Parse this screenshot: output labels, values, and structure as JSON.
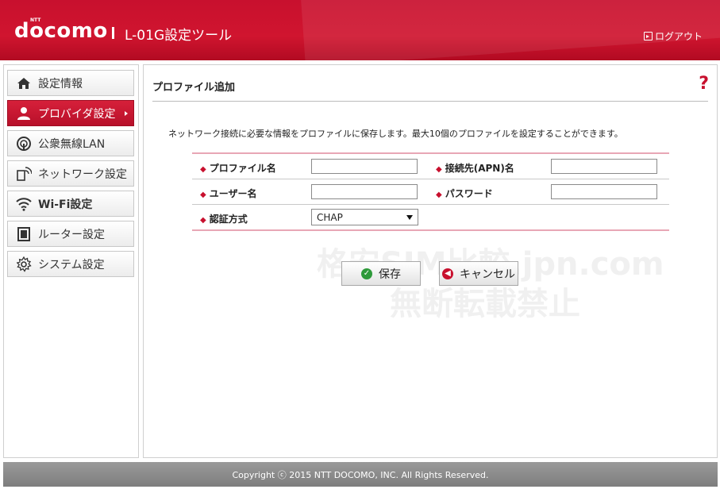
{
  "header": {
    "logo": "docomo",
    "logo_small": "NTT",
    "tool_title": "L-01G設定ツール",
    "logout_label": "ログアウト"
  },
  "sidebar": {
    "items": [
      {
        "label": "設定情報",
        "icon": "home-icon"
      },
      {
        "label": "プロバイダ設定",
        "icon": "user-icon",
        "active": true
      },
      {
        "label": "公衆無線LAN",
        "icon": "public-wifi-icon"
      },
      {
        "label": "ネットワーク設定",
        "icon": "network-icon"
      },
      {
        "label": "Wi-Fi設定",
        "icon": "wifi-icon"
      },
      {
        "label": "ルーター設定",
        "icon": "router-icon"
      },
      {
        "label": "システム設定",
        "icon": "gear-icon"
      }
    ]
  },
  "main": {
    "title": "プロファイル追加",
    "help": "?",
    "description": "ネットワーク接続に必要な情報をプロファイルに保存します。最大10個のプロファイルを設定することができます。",
    "form": {
      "profile_name_label": "プロファイル名",
      "profile_name_value": "",
      "apn_label": "接続先(APN)名",
      "apn_value": "",
      "username_label": "ユーザー名",
      "username_value": "",
      "password_label": "パスワード",
      "password_value": "",
      "auth_label": "認証方式",
      "auth_value": "CHAP"
    },
    "save_label": "保存",
    "cancel_label": "キャンセル"
  },
  "watermark": {
    "line1": "格安SIM比較.jpn.com",
    "line2": "無断転載禁止"
  },
  "footer": {
    "copyright": "Copyright ⓒ 2015 NTT DOCOMO, INC. All Rights Reserved."
  },
  "colors": {
    "brand_red": "#c8102e",
    "footer_gray": "#8a8a8a",
    "table_rule": "#e8a7b5"
  }
}
